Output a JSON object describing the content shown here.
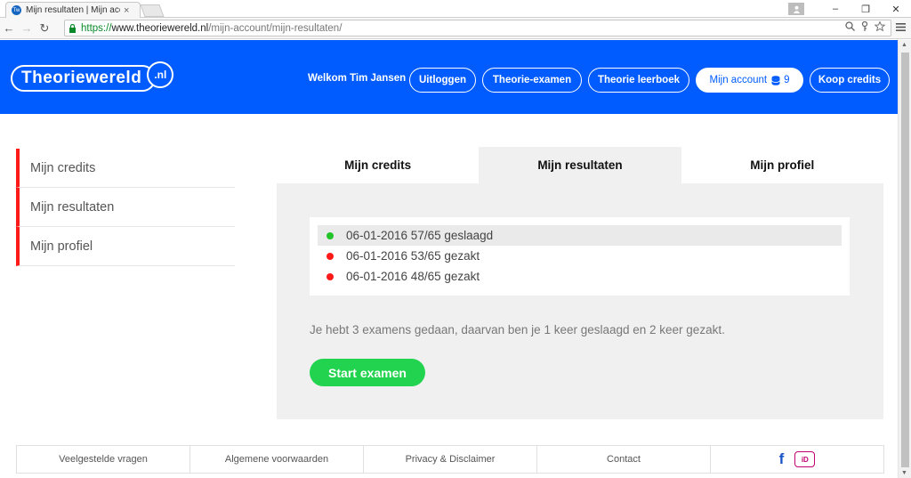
{
  "browser": {
    "tab_title": "Mijn resultaten | Mijn acco",
    "tab_favicon": "Tw",
    "tab_close": "×",
    "url_scheme": "https://",
    "url_host": "www.theoriewereld.nl",
    "url_path": "/mijn-account/mijn-resultaten/",
    "controls": {
      "minimize": "–",
      "restore": "❐",
      "close": "✕"
    }
  },
  "header": {
    "logo_main": "Theoriewereld",
    "logo_nl": ".nl",
    "welcome": "Welkom Tim Jansen",
    "logout": "Uitloggen",
    "theory_exam": "Theorie-examen",
    "theory_book": "Theorie leerboek",
    "my_account": "Mijn account",
    "credits": "9",
    "buy_credits": "Koop credits",
    "brand_color": "#005cff"
  },
  "sidebar": {
    "items": [
      {
        "label": "Mijn credits"
      },
      {
        "label": "Mijn resultaten"
      },
      {
        "label": "Mijn profiel"
      }
    ],
    "accent_color": "#ff1a1a"
  },
  "tabs": [
    {
      "label": "Mijn credits",
      "active": false
    },
    {
      "label": "Mijn resultaten",
      "active": true
    },
    {
      "label": "Mijn profiel",
      "active": false
    }
  ],
  "results": [
    {
      "text": "06-01-2016 57/65 geslaagd",
      "status_color": "#22c42a"
    },
    {
      "text": "06-01-2016 53/65 gezakt",
      "status_color": "#ff1a1a"
    },
    {
      "text": "06-01-2016 48/65 gezakt",
      "status_color": "#ff1a1a"
    }
  ],
  "summary": "Je hebt 3 examens gedaan, daarvan ben je 1 keer geslaagd en 2 keer gezakt.",
  "start_button": "Start examen",
  "footer": {
    "faq": "Veelgestelde vragen",
    "terms": "Algemene voorwaarden",
    "privacy": "Privacy & Disclaimer",
    "contact": "Contact",
    "facebook": "f",
    "ideal": "iD"
  }
}
